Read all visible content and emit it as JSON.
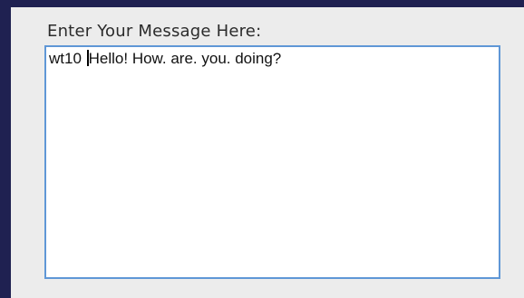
{
  "form": {
    "label": "Enter Your Message Here:",
    "message": {
      "before_cursor": "wt10 ",
      "after_cursor": "Hello! How. are. you. doing?"
    }
  },
  "colors": {
    "outer_background": "#1f2151",
    "panel_background": "#ececec",
    "field_border": "#5f97d6",
    "field_background": "#ffffff",
    "text": "#111111"
  }
}
